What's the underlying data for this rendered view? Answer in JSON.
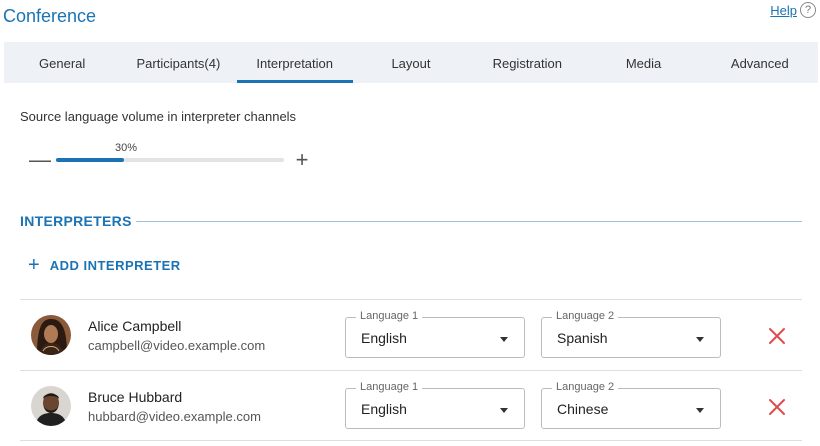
{
  "header": {
    "title": "Conference",
    "help_label": "Help",
    "help_icon": "?"
  },
  "tabs": [
    {
      "label": "General",
      "active": false
    },
    {
      "label": "Participants(4)",
      "active": false
    },
    {
      "label": "Interpretation",
      "active": true
    },
    {
      "label": "Layout",
      "active": false
    },
    {
      "label": "Registration",
      "active": false
    },
    {
      "label": "Media",
      "active": false
    },
    {
      "label": "Advanced",
      "active": false
    }
  ],
  "volume": {
    "label": "Source language volume in interpreter channels",
    "value_text": "30%",
    "value": 0.3,
    "minus_symbol": "—",
    "plus_symbol": "+"
  },
  "interpreters": {
    "title": "INTERPRETERS",
    "add_label": "ADD INTERPRETER",
    "add_symbol": "+",
    "rows": [
      {
        "name": "Alice Campbell",
        "email": "campbell@video.example.com",
        "language1_label": "Language 1",
        "language1": "English",
        "language2_label": "Language 2",
        "language2": "Spanish"
      },
      {
        "name": "Bruce Hubbard",
        "email": "hubbard@video.example.com",
        "language1_label": "Language 1",
        "language1": "English",
        "language2_label": "Language 2",
        "language2": "Chinese"
      }
    ]
  },
  "colors": {
    "accent": "#1a73b5",
    "remove": "#e04b4b",
    "tab_bar": "#eef2f6"
  }
}
